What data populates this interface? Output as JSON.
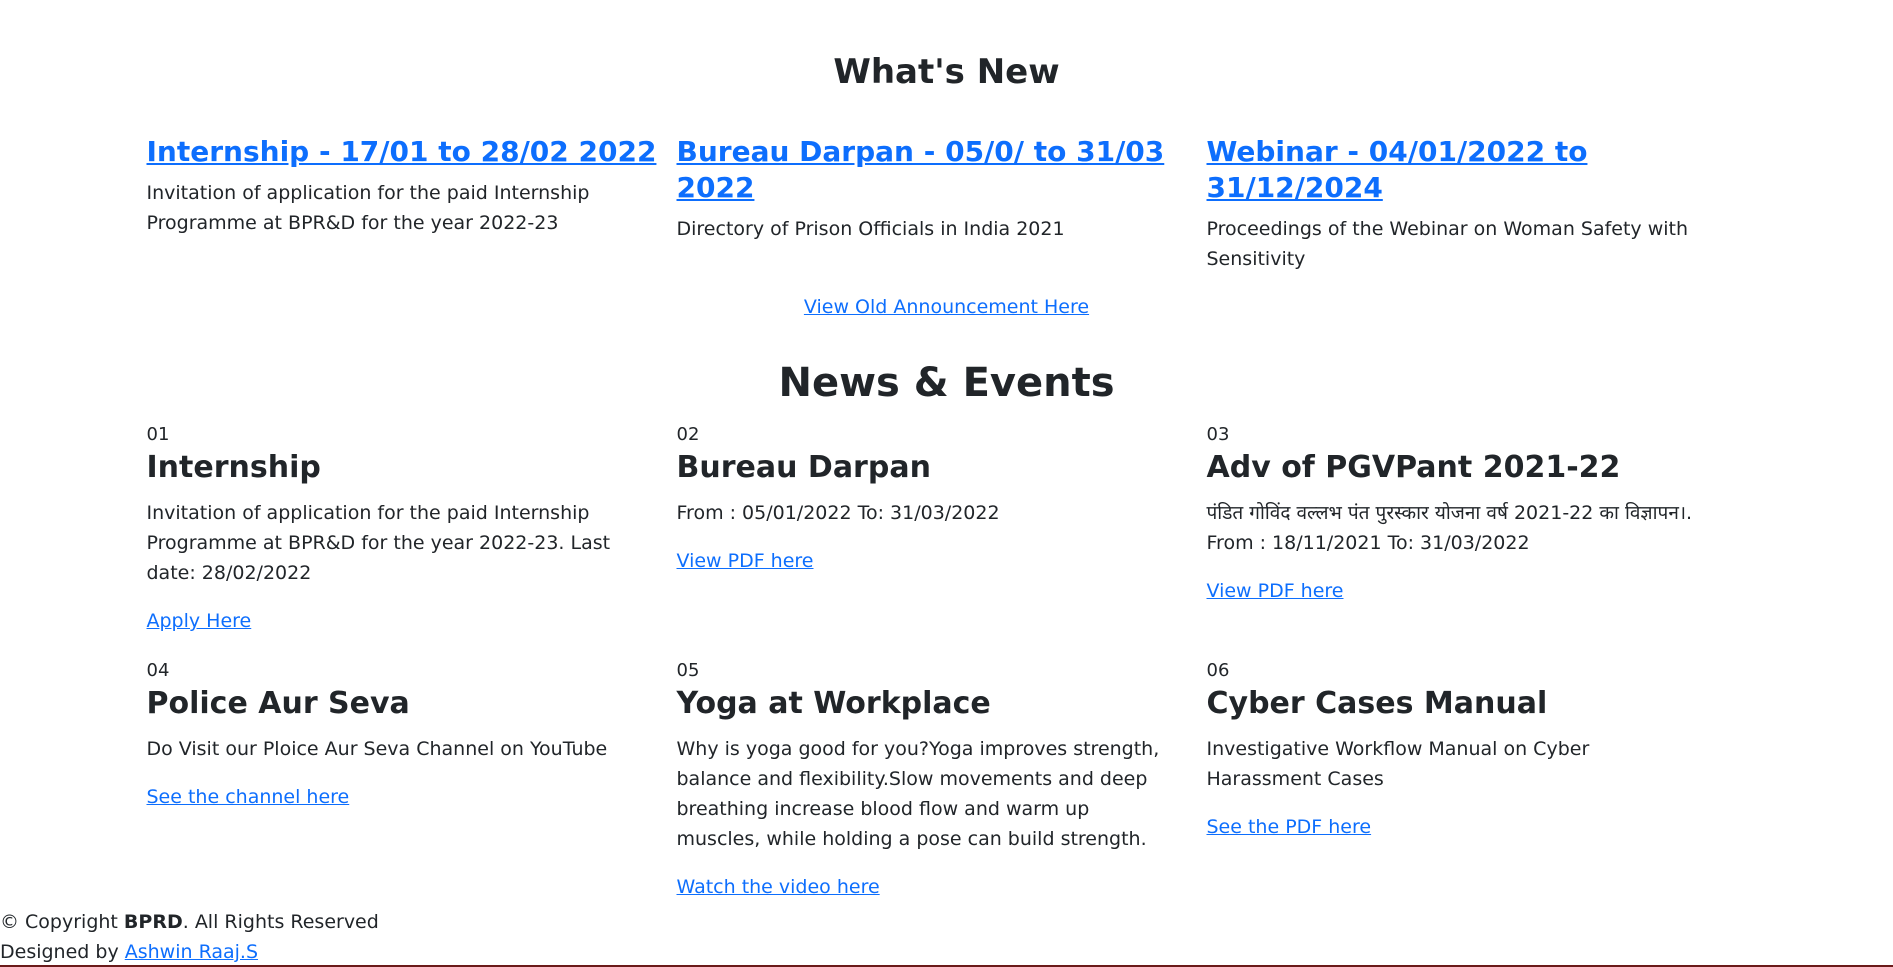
{
  "whats_new": {
    "title": "What's New",
    "items": [
      {
        "heading": "Internship - 17/01 to 28/02 2022",
        "text": "Invitation of application for the paid Internship Programme at BPR&D for the year 2022-23"
      },
      {
        "heading": "Bureau Darpan - 05/0/ to 31/03 2022",
        "text": "Directory of Prison Officials in India 2021"
      },
      {
        "heading": "Webinar - 04/01/2022 to 31/12/2024",
        "text": "Proceedings of the Webinar on Woman Safety with Sensitivity"
      }
    ],
    "old_link": "View Old Announcement Here"
  },
  "news_events": {
    "title": "News & Events",
    "items": [
      {
        "num": "01",
        "title": "Internship",
        "text": "Invitation of application for the paid Internship Programme at BPR&D for the year 2022-23. Last date: 28/02/2022",
        "link": "Apply Here"
      },
      {
        "num": "02",
        "title": "Bureau Darpan",
        "text": "From : 05/01/2022 To: 31/03/2022",
        "link": "View PDF here"
      },
      {
        "num": "03",
        "title": "Adv of PGVPant 2021-22",
        "text": "पंडित गोविंद वल्लभ पंत पुरस्कार योजना वर्ष 2021-22 का विज्ञापन।. From : 18/11/2021 To: 31/03/2022",
        "link": "View PDF here"
      },
      {
        "num": "04",
        "title": "Police Aur Seva",
        "text": "Do Visit our Ploice Aur Seva Channel on YouTube",
        "link": "See the channel here"
      },
      {
        "num": "05",
        "title": "Yoga at Workplace",
        "text": "Why is yoga good for you?Yoga improves strength, balance and flexibility.Slow movements and deep breathing increase blood flow and warm up muscles, while holding a pose can build strength.",
        "link": "Watch the video here"
      },
      {
        "num": "06",
        "title": "Cyber Cases Manual",
        "text": "Investigative Workflow Manual on Cyber Harassment Cases",
        "link": "See the PDF here"
      }
    ]
  },
  "footer": {
    "copyright_prefix": "© Copyright ",
    "brand": "BPRD",
    "copyright_suffix": ". All Rights Reserved",
    "designed_by_label": "Designed by ",
    "designer": "Ashwin Raaj.S"
  },
  "colors": {
    "link": "#0d6efd",
    "text": "#212529",
    "bottom_bar": "#6b1a1a"
  }
}
